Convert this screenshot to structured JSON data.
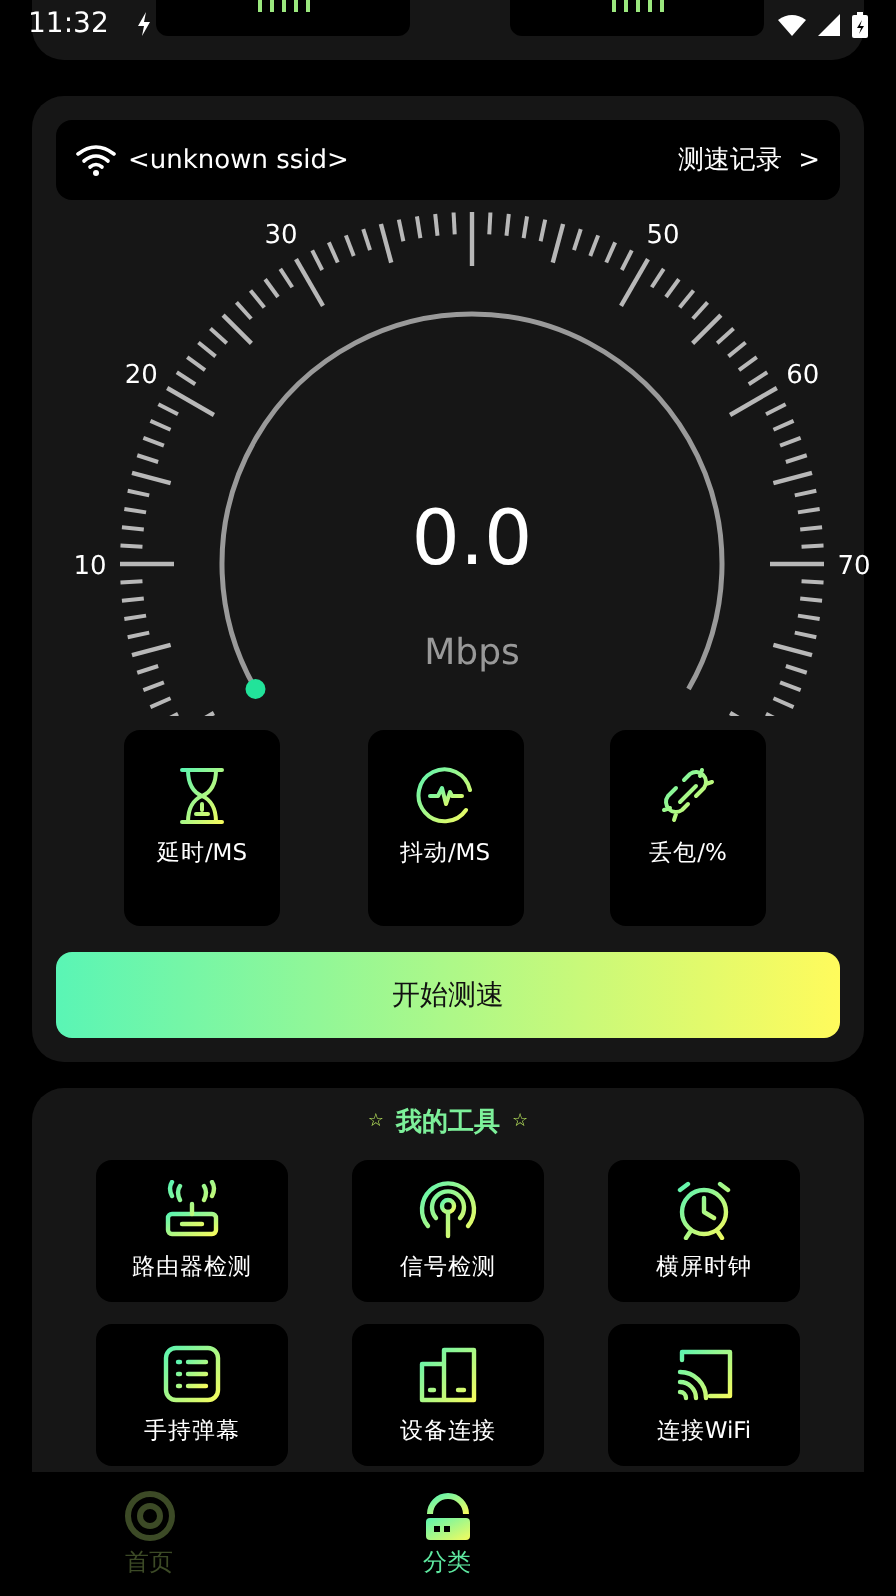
{
  "status_bar": {
    "time": "11:32"
  },
  "network": {
    "ssid": "<unknown ssid>",
    "history_link": "测速记录  >"
  },
  "gauge": {
    "scale": [
      "10",
      "20",
      "30",
      "50",
      "60",
      "70"
    ],
    "reading": "0.0",
    "unit": "Mbps"
  },
  "metrics": [
    {
      "label": "延时/MS"
    },
    {
      "label": "抖动/MS"
    },
    {
      "label": "丢包/%"
    }
  ],
  "start_button": "开始测速",
  "tools": {
    "title_marks": [
      "☆",
      "☆"
    ],
    "title": "我的工具",
    "items": [
      {
        "label": "路由器检测"
      },
      {
        "label": "信号检测"
      },
      {
        "label": "横屏时钟"
      },
      {
        "label": "手持弹幕"
      },
      {
        "label": "设备连接"
      },
      {
        "label": "连接WiFi"
      }
    ]
  },
  "nav": [
    {
      "label": "首页",
      "selected": false
    },
    {
      "label": "分类",
      "selected": true
    }
  ]
}
